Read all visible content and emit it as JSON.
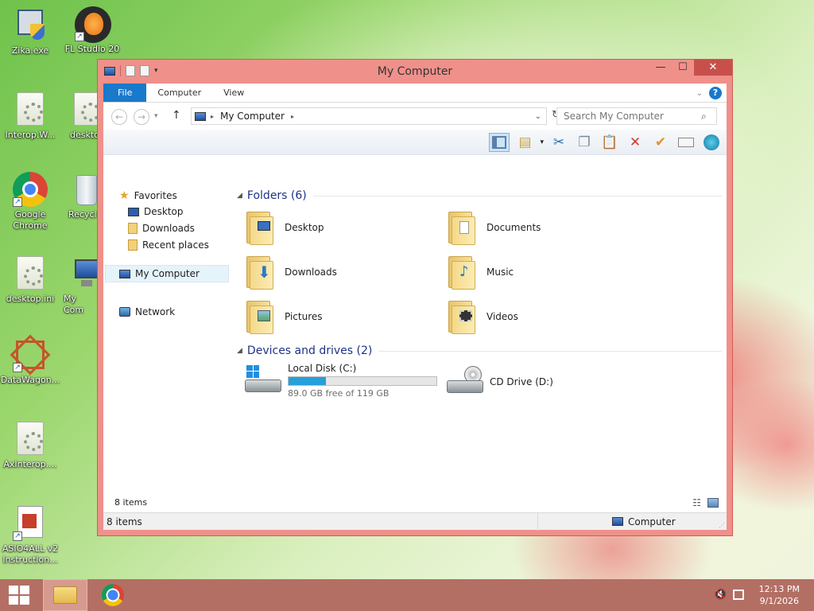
{
  "desktop": {
    "icons": [
      {
        "label": "Zika.exe"
      },
      {
        "label": "FL Studio 20"
      },
      {
        "label": "Interop.W..."
      },
      {
        "label": "deskto"
      },
      {
        "label": "Google Chrome"
      },
      {
        "label": "Recycl"
      },
      {
        "label": "desktop.ini"
      },
      {
        "label": "My Com"
      },
      {
        "label": "DataWagon..."
      },
      {
        "label": "AxInterop...."
      },
      {
        "label": "ASIO4ALL v2 Instruction..."
      }
    ]
  },
  "window": {
    "title": "My Computer",
    "ribbon_tabs": [
      "File",
      "Computer",
      "View"
    ],
    "address": {
      "path": "My Computer"
    },
    "search": {
      "placeholder": "Search My Computer"
    },
    "nav": {
      "favorites": "Favorites",
      "desktop": "Desktop",
      "downloads": "Downloads",
      "recent": "Recent places",
      "my_computer": "My Computer",
      "network": "Network"
    },
    "groups": {
      "folders": "Folders (6)",
      "devices": "Devices and drives (2)"
    },
    "folders": [
      {
        "name": "Desktop"
      },
      {
        "name": "Documents"
      },
      {
        "name": "Downloads"
      },
      {
        "name": "Music"
      },
      {
        "name": "Pictures"
      },
      {
        "name": "Videos"
      }
    ],
    "drives": [
      {
        "name": "Local Disk (C:)",
        "free": "89.0 GB free of 119 GB",
        "used_fraction": 0.252
      },
      {
        "name": "CD Drive (D:)"
      }
    ],
    "inner_status": "8 items",
    "statusbar": {
      "left": "8 items",
      "right": "Computer"
    },
    "colors": {
      "accent": "#1979ca",
      "frame": "#f0908a",
      "close": "#c7504b",
      "progress": "#26a0da"
    }
  },
  "taskbar": {
    "time": "12:13 PM",
    "date": "9/1/2026"
  }
}
